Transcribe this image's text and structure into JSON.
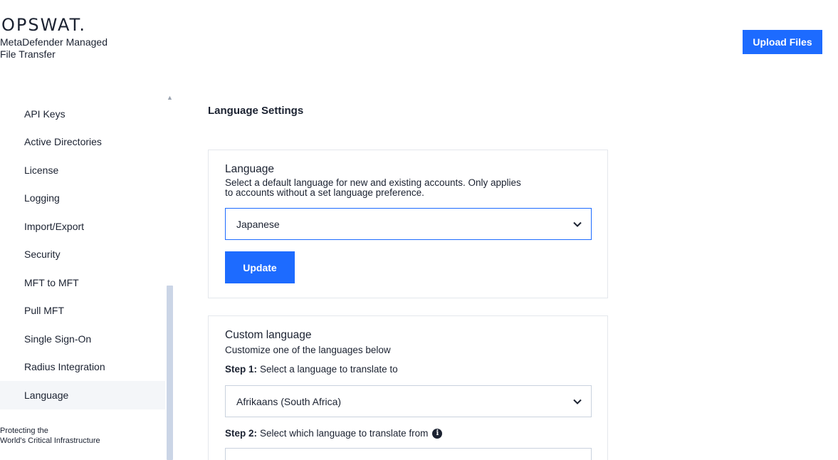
{
  "brand": {
    "logo": "OPSWAT.",
    "product_line1": "MetaDefender Managed",
    "product_line2": "File Transfer"
  },
  "header": {
    "upload_label": "Upload Files"
  },
  "sidebar": {
    "items": [
      {
        "label": "API Keys",
        "active": false
      },
      {
        "label": "Active Directories",
        "active": false
      },
      {
        "label": "License",
        "active": false
      },
      {
        "label": "Logging",
        "active": false
      },
      {
        "label": "Import/Export",
        "active": false
      },
      {
        "label": "Security",
        "active": false
      },
      {
        "label": "MFT to MFT",
        "active": false
      },
      {
        "label": "Pull MFT",
        "active": false
      },
      {
        "label": "Single Sign-On",
        "active": false
      },
      {
        "label": "Radius Integration",
        "active": false
      },
      {
        "label": "Language",
        "active": true
      }
    ],
    "footer_line1": "Protecting the",
    "footer_line2": "World's Critical Infrastructure"
  },
  "main": {
    "title": "Language Settings",
    "language_card": {
      "heading": "Language",
      "description": "Select a default language for new and existing accounts. Only applies to accounts without a set language preference.",
      "selected_language": "Japanese",
      "update_label": "Update"
    },
    "custom_card": {
      "heading": "Custom language",
      "description": "Customize one of the languages below",
      "step1_label": "Step 1:",
      "step1_text": "Select a language to translate to",
      "step1_value": "Afrikaans (South Africa)",
      "step2_label": "Step 2:",
      "step2_text": "Select which language to translate from",
      "step2_value": ""
    }
  },
  "colors": {
    "accent": "#1d6bff",
    "active_bg": "#f4f6f9",
    "border": "#e4e7ec",
    "scrollbar": "#cbd5e6"
  }
}
